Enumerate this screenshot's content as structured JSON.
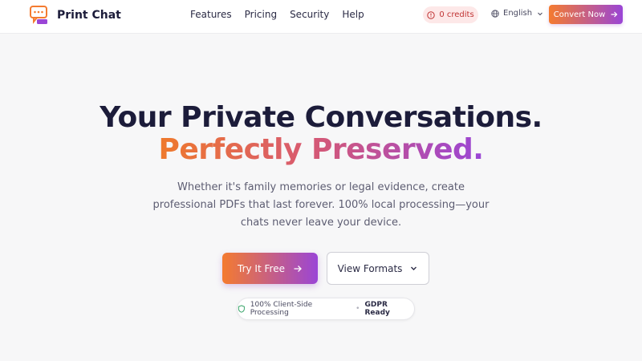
{
  "brand": {
    "name": "Print Chat"
  },
  "nav": {
    "links": [
      "Features",
      "Pricing",
      "Security",
      "Help"
    ]
  },
  "credits": {
    "label": "0 credits"
  },
  "language": {
    "label": "English"
  },
  "header_cta": {
    "label": "Convert Now"
  },
  "hero": {
    "title_line1": "Your Private Conversations.",
    "title_line2": "Perfectly Preserved.",
    "subtitle": "Whether it's family memories or legal evidence, create professional PDFs that last forever. 100% local processing—your chats never leave your device."
  },
  "buttons": {
    "try_free": "Try It Free",
    "view_formats": "View Formats"
  },
  "badge": {
    "processing": "100% Client-Side Processing",
    "separator": "•",
    "gdpr": "GDPR Ready"
  },
  "colors": {
    "accent_start": "#f47b30",
    "accent_end": "#9a45d6",
    "text_dark": "#1c1c3a"
  }
}
